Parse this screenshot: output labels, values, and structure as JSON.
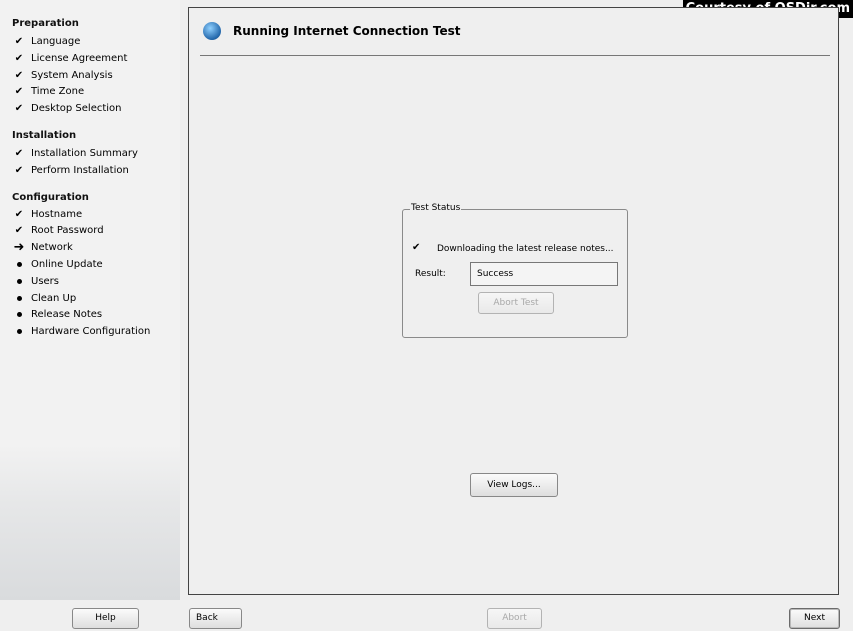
{
  "watermark": "Courtesy of OSDir.com",
  "sidebar": {
    "sections": [
      {
        "title": "Preparation",
        "steps": [
          {
            "label": "Language",
            "status": "done"
          },
          {
            "label": "License Agreement",
            "status": "done"
          },
          {
            "label": "System Analysis",
            "status": "done"
          },
          {
            "label": "Time Zone",
            "status": "done"
          },
          {
            "label": "Desktop Selection",
            "status": "done"
          }
        ]
      },
      {
        "title": "Installation",
        "steps": [
          {
            "label": "Installation Summary",
            "status": "done"
          },
          {
            "label": "Perform Installation",
            "status": "done"
          }
        ]
      },
      {
        "title": "Configuration",
        "steps": [
          {
            "label": "Hostname",
            "status": "done"
          },
          {
            "label": "Root Password",
            "status": "done"
          },
          {
            "label": "Network",
            "status": "current"
          },
          {
            "label": "Online Update",
            "status": "pending"
          },
          {
            "label": "Users",
            "status": "pending"
          },
          {
            "label": "Clean Up",
            "status": "pending"
          },
          {
            "label": "Release Notes",
            "status": "pending"
          },
          {
            "label": "Hardware Configuration",
            "status": "pending"
          }
        ]
      }
    ]
  },
  "main": {
    "title": "Running Internet Connection Test",
    "title_icon": "globe-icon",
    "test_status": {
      "legend": "Test Status",
      "current_step": "Downloading the latest release notes...",
      "result_label": "Result:",
      "result_value": "Success",
      "abort_test_label": "Abort Test"
    },
    "view_logs_label": "View Logs..."
  },
  "footer": {
    "help_label": "Help",
    "back_label": "Back",
    "abort_label": "Abort",
    "next_label": "Next"
  }
}
